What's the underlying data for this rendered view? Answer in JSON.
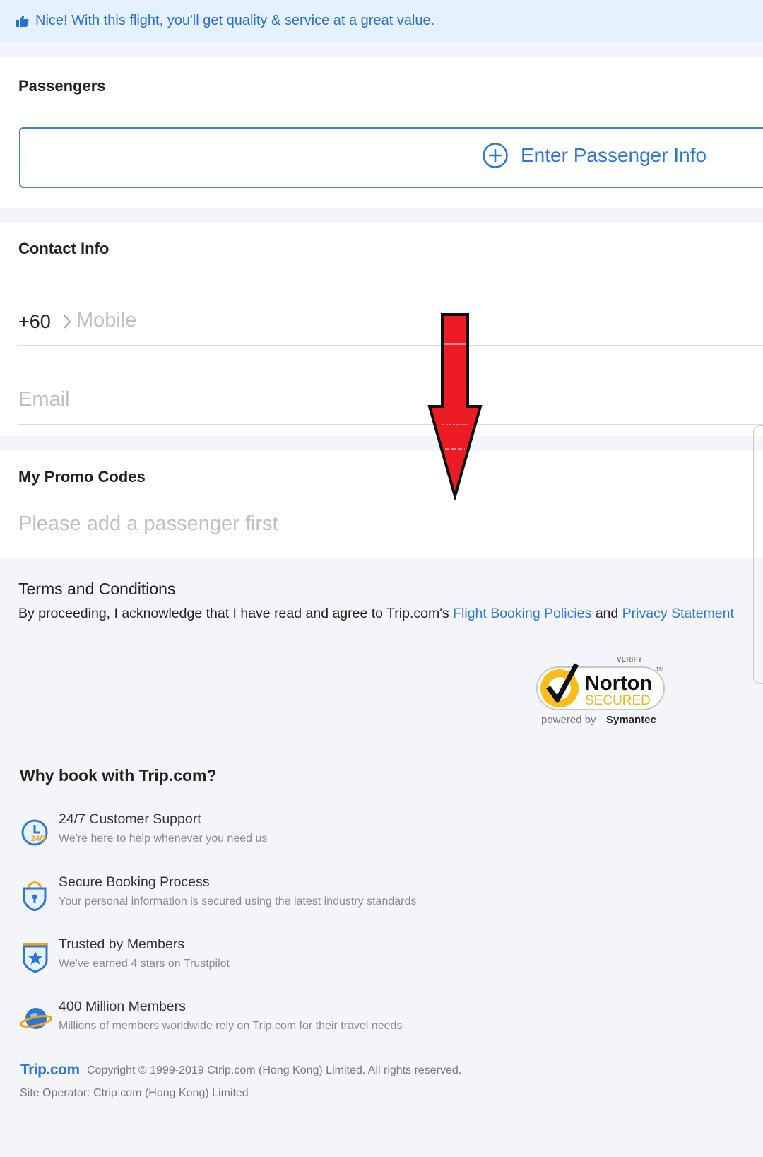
{
  "banner": {
    "text": "Nice! With this flight, you'll get quality & service at a great value.",
    "icon": "thumbs-up-icon"
  },
  "passengers": {
    "title": "Passengers",
    "button_label": "Enter Passenger Info",
    "button_icon": "plus-circle-icon"
  },
  "contact": {
    "title": "Contact Info",
    "country_code": "+60",
    "mobile_placeholder": "Mobile",
    "email_placeholder": "Email"
  },
  "promo": {
    "title": "My Promo Codes",
    "placeholder": "Please add a passenger first"
  },
  "terms": {
    "title": "Terms and Conditions",
    "text_prefix": "By proceeding, I acknowledge that I have read and agree to Trip.com's ",
    "link_policies": "Flight Booking Policies",
    "text_and": " and ",
    "link_privacy": "Privacy Statement"
  },
  "norton": {
    "verify": "VERIFY",
    "name": "Norton",
    "secured": "SECURED",
    "powered_by": "powered by",
    "company": "Symantec",
    "tm": "TM"
  },
  "why": {
    "title": "Why book with Trip.com?",
    "features": [
      {
        "title": "24/7 Customer Support",
        "subtitle": "We're here to help whenever you need us",
        "icon": "clock-247-icon",
        "badge": "24/7"
      },
      {
        "title": "Secure Booking Process",
        "subtitle": "Your personal information is secured using the latest industry standards",
        "icon": "lock-shield-icon"
      },
      {
        "title": "Trusted by Members",
        "subtitle": "We've earned 4 stars on Trustpilot",
        "icon": "star-badge-icon"
      },
      {
        "title": "400 Million Members",
        "subtitle": "Millions of members worldwide rely on Trip.com for their travel needs",
        "icon": "globe-members-icon"
      }
    ]
  },
  "footer": {
    "brand": "Trip.com",
    "copyright": "Copyright © 1999-2019 Ctrip.com (Hong Kong) Limited. All rights reserved.",
    "operator": "Site Operator: Ctrip.com (Hong Kong) Limited"
  },
  "colors": {
    "accent": "#2f77d6",
    "banner_bg": "#e6f1fe",
    "arrow_red": "#ed1c24"
  }
}
